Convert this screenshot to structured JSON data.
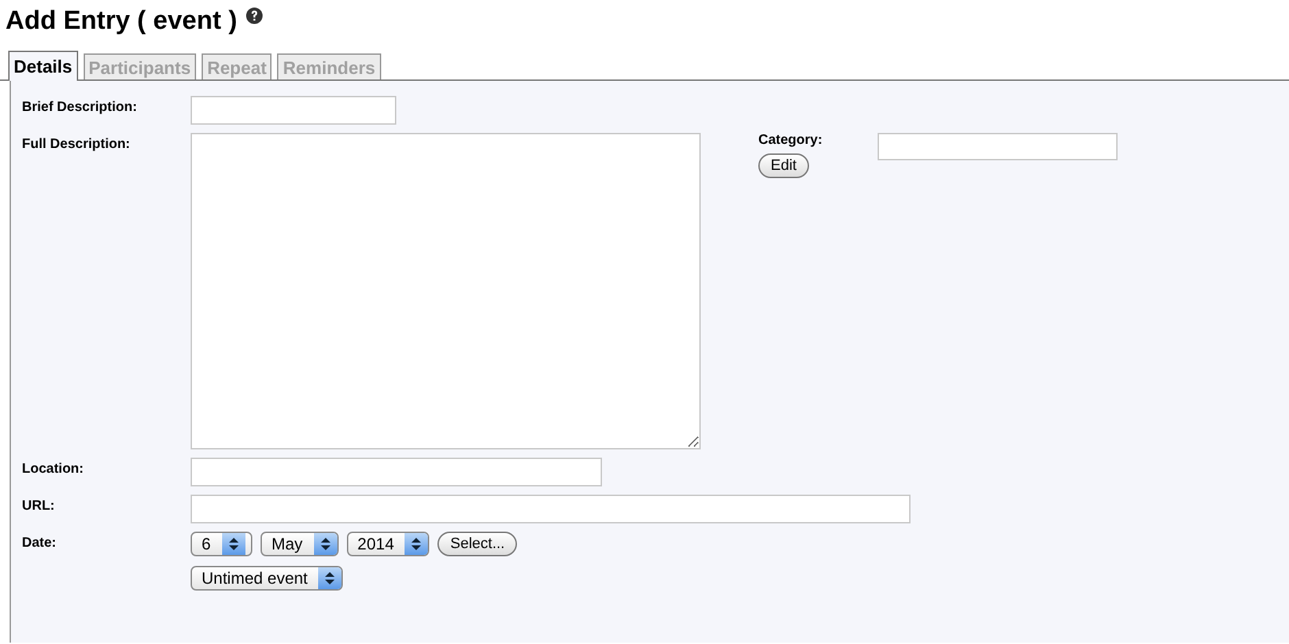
{
  "title": "Add Entry ( event )",
  "tabs": [
    {
      "label": "Details",
      "selected": true
    },
    {
      "label": "Participants",
      "selected": false
    },
    {
      "label": "Repeat",
      "selected": false
    },
    {
      "label": "Reminders",
      "selected": false
    }
  ],
  "form": {
    "brief_description": {
      "label": "Brief Description:"
    },
    "full_description": {
      "label": "Full Description:"
    },
    "category": {
      "label": "Category:",
      "button": "Edit"
    },
    "location": {
      "label": "Location:"
    },
    "url": {
      "label": "URL:"
    },
    "date": {
      "label": "Date:",
      "day": "6",
      "month": "May",
      "year": "2014",
      "button": "Select...",
      "time_type": "Untimed event"
    }
  }
}
